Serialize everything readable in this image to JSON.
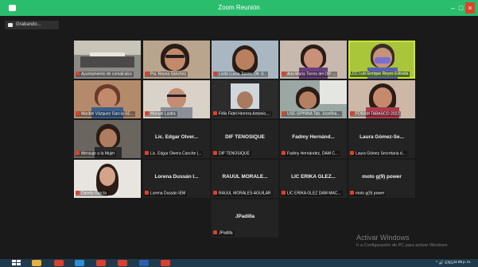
{
  "window": {
    "title": "Zoom Reunión",
    "minimize": "–",
    "maximize": "□",
    "close": "×"
  },
  "recording": {
    "label": "Grabando..."
  },
  "participants": [
    {
      "label": "Ayuntamiento de comalcalco",
      "initials": "",
      "kind": "video",
      "muted": true
    },
    {
      "label": "Psi. Reyna Sánchez",
      "initials": "",
      "kind": "video",
      "muted": true
    },
    {
      "label": "Licda Lucila Torres, Dir. d...",
      "initials": "",
      "kind": "video",
      "muted": true
    },
    {
      "label": "Ana Maria Torres del DIF ...",
      "initials": "",
      "kind": "video",
      "muted": true
    },
    {
      "label": "LCC Luis Enrique Reyes Estrada",
      "initials": "",
      "kind": "video",
      "muted": false,
      "active": true
    },
    {
      "label": "Maribel Vázquez García SE...",
      "initials": "",
      "kind": "video",
      "muted": true
    },
    {
      "label": "Manuel Lastra",
      "initials": "",
      "kind": "video",
      "muted": true
    },
    {
      "label": "Félix Fidel Herrera Antonio,...",
      "initials": "",
      "kind": "video",
      "muted": true
    },
    {
      "label": "USE-SIPINNA Tab. Josefina...",
      "initials": "",
      "kind": "video",
      "muted": true
    },
    {
      "label": "FOBAM TABASCO 2022",
      "initials": "",
      "kind": "video",
      "muted": true
    },
    {
      "label": "Mensaje a la Mujer",
      "initials": "",
      "kind": "video",
      "muted": true
    },
    {
      "label": "Lic. Edgar Olvera Canche (...",
      "initials": "Lic. Edgar Olver...",
      "kind": "name",
      "muted": true
    },
    {
      "label": "DIF TENOSIQUE",
      "initials": "DIF TENOSIQUE",
      "kind": "name",
      "muted": true
    },
    {
      "label": "Fadmy Hernández, DAM C...",
      "initials": "Fadmy Hernánd...",
      "kind": "name",
      "muted": true
    },
    {
      "label": "Laura Gómez Secretaria d...",
      "initials": "Laura Gómez-Se...",
      "kind": "name",
      "muted": true
    },
    {
      "label": "Danely García",
      "initials": "",
      "kind": "video",
      "muted": true
    },
    {
      "label": "Lorena Dussán IEM",
      "initials": "Lorena Dussán I...",
      "kind": "name",
      "muted": true
    },
    {
      "label": "RAUUL MORALES AGUILAR",
      "initials": "RAUUL MORALE...",
      "kind": "name",
      "muted": true
    },
    {
      "label": "LIC ERIKA GLEZ DAM MAC...",
      "initials": "LIC ERIKA GLEZ...",
      "kind": "name",
      "muted": true
    },
    {
      "label": "moto g(9) power",
      "initials": "moto g(9) power",
      "kind": "name",
      "muted": true
    },
    {
      "label": "JPadilla",
      "initials": "JPadilla",
      "kind": "name",
      "muted": true
    }
  ],
  "watermark": {
    "title": "Activar Windows",
    "subtitle": "Ir a Configuración de PC para activar Windows."
  },
  "taskbar": {
    "clock": "11:09 p. m.",
    "tray": "^ 🔊 ENG",
    "icons": [
      {
        "name": "file-explorer-icon",
        "color": "#e8b23a"
      },
      {
        "name": "chrome-icon",
        "color": "#d8412f"
      },
      {
        "name": "edge-icon",
        "color": "#2d8fd6"
      },
      {
        "name": "chrome-icon",
        "color": "#d8412f"
      },
      {
        "name": "chrome-icon",
        "color": "#d8412f"
      },
      {
        "name": "word-icon",
        "color": "#2b5fad"
      },
      {
        "name": "chrome-icon",
        "color": "#d8412f"
      }
    ]
  },
  "colors": {
    "titlebar": "#2bbd6e",
    "active_speaker": "#c8e532",
    "muted_mic": "#e0402b",
    "background": "#1a1a1a"
  }
}
